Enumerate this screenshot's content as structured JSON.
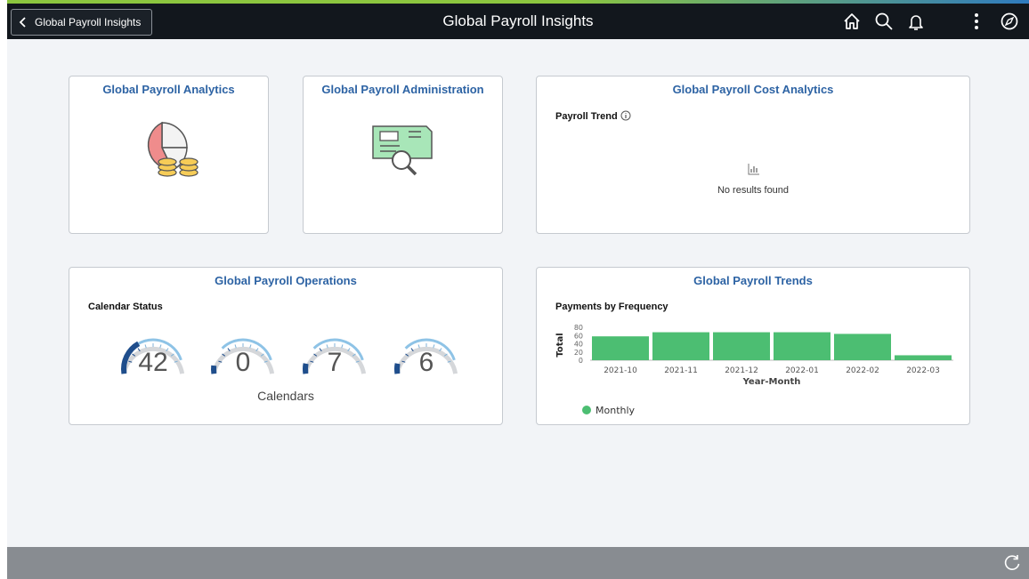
{
  "header": {
    "back_label": "Global Payroll Insights",
    "title": "Global Payroll Insights",
    "icons": [
      "home-icon",
      "search-icon",
      "notification-bell-icon",
      "actions-menu-icon",
      "navbar-compass-icon"
    ]
  },
  "tiles": {
    "analytics": {
      "title": "Global Payroll Analytics",
      "icon": "pie-chart-coins-icon"
    },
    "administration": {
      "title": "Global Payroll Administration",
      "icon": "check-magnifier-icon"
    },
    "cost": {
      "title": "Global Payroll Cost Analytics",
      "subtitle": "Payroll Trend",
      "empty_message": "No results found",
      "info_icon": "info-icon",
      "empty_icon": "chart-empty-icon"
    },
    "operations": {
      "title": "Global Payroll Operations",
      "subtitle": "Calendar Status",
      "caption": "Calendars",
      "gauges": [
        {
          "value": "42",
          "level": 0.35
        },
        {
          "value": "0",
          "level": 0.0
        },
        {
          "value": "7",
          "level": 0.1
        },
        {
          "value": "6",
          "level": 0.1
        }
      ]
    },
    "trends": {
      "title": "Global Payroll Trends",
      "subtitle": "Payments by Frequency"
    }
  },
  "chart_data": {
    "type": "bar",
    "categories": [
      "2021-10",
      "2021-11",
      "2021-12",
      "2022-01",
      "2022-02",
      "2022-03"
    ],
    "series": [
      {
        "name": "Monthly",
        "values": [
          58,
          68,
          68,
          68,
          64,
          12
        ]
      }
    ],
    "yticks": [
      0,
      20,
      40,
      60,
      80
    ],
    "ylim": [
      0,
      80
    ],
    "xlabel": "Year-Month",
    "ylabel": "Total",
    "legend": "bottom-left",
    "color": "#4cbe72"
  },
  "colors": {
    "header_bg": "#12171d",
    "tile_title": "#2d63a4",
    "bar": "#4cbe72",
    "gauge_dark": "#1f4e8c",
    "gauge_light": "#8ec3e6",
    "footer": "#888c91"
  },
  "footer": {
    "refresh_icon": "refresh-icon"
  }
}
